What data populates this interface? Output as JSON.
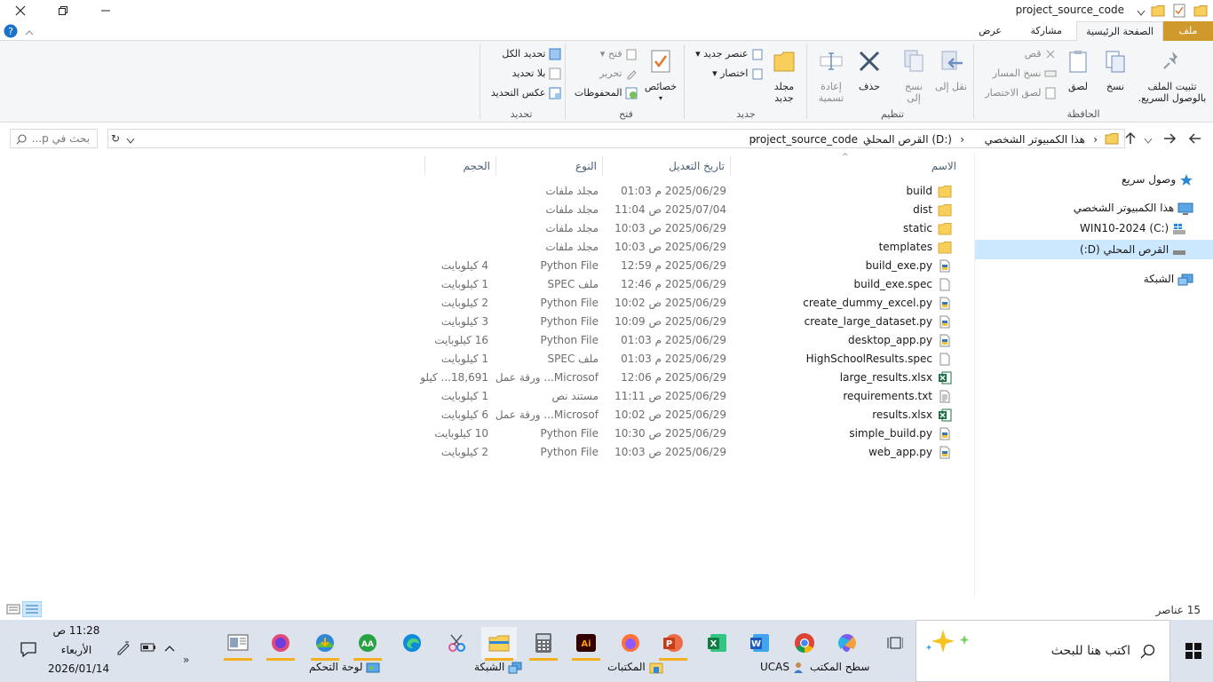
{
  "window": {
    "title": "project_source_code"
  },
  "tabs": [
    {
      "label": "ملف"
    },
    {
      "label": "الصفحة الرئيسية"
    },
    {
      "label": "مشاركة"
    },
    {
      "label": "عرض"
    }
  ],
  "ribbon": {
    "clipboard": {
      "group_label": "الحافظة",
      "pin_label": "تثبيت الملف بالوصول السريع.",
      "copy_label": "نسخ",
      "paste_label": "لصق",
      "cut_label": "قص",
      "copy_path_label": "نسخ المسار",
      "paste_shortcut_label": "لصق الاختصار"
    },
    "organize": {
      "group_label": "تنظيم",
      "move_label": "نقل إلى",
      "copyto_label": "نسخ إلى",
      "delete_label": "حذف",
      "rename_label": "إعادة تسمية"
    },
    "new": {
      "group_label": "جديد",
      "new_folder_label": "مجلد جديد",
      "new_item_label": "عنصر جديد",
      "easy_access_label": "اختصار"
    },
    "open": {
      "group_label": "فتح",
      "properties_label": "خصائص",
      "open_label": "فتح",
      "edit_label": "تحرير",
      "history_label": "المحفوظات"
    },
    "select": {
      "group_label": "تحديد",
      "select_all_label": "تحديد الكل",
      "select_none_label": "بلا تحديد",
      "invert_label": "عكس التحديد"
    }
  },
  "address": {
    "crumbs": [
      "هذا الكمبيوتر الشخصي",
      "القرص المحلي (D:)",
      "project_source_code"
    ],
    "search_placeholder": "بحث في p..."
  },
  "nav": {
    "items": [
      {
        "label": "وصول سريع"
      },
      {
        "label": "هذا الكمبيوتر الشخصي"
      },
      {
        "label": "WIN10-2024 (C:)"
      },
      {
        "label": "القرص المحلي (D:)"
      },
      {
        "label": "الشبكة"
      }
    ]
  },
  "columns": {
    "name": "الاسم",
    "date": "تاريخ التعديل",
    "type": "النوع",
    "size": "الحجم"
  },
  "files": [
    {
      "name": "build",
      "date": "2025/06/29 م 01:03",
      "type": "مجلد ملفات",
      "size": "",
      "icon": "folder"
    },
    {
      "name": "dist",
      "date": "2025/07/04 ص 11:04",
      "type": "مجلد ملفات",
      "size": "",
      "icon": "folder"
    },
    {
      "name": "static",
      "date": "2025/06/29 ص 10:03",
      "type": "مجلد ملفات",
      "size": "",
      "icon": "folder"
    },
    {
      "name": "templates",
      "date": "2025/06/29 ص 10:03",
      "type": "مجلد ملفات",
      "size": "",
      "icon": "folder"
    },
    {
      "name": "build_exe.py",
      "date": "2025/06/29 م 12:59",
      "type": "Python File",
      "size": "4 كيلوبايت",
      "icon": "python"
    },
    {
      "name": "build_exe.spec",
      "date": "2025/06/29 م 12:46",
      "type": "ملف SPEC",
      "size": "1 كيلوبايت",
      "icon": "blank"
    },
    {
      "name": "create_dummy_excel.py",
      "date": "2025/06/29 ص 10:02",
      "type": "Python File",
      "size": "2 كيلوبايت",
      "icon": "python"
    },
    {
      "name": "create_large_dataset.py",
      "date": "2025/06/29 ص 10:09",
      "type": "Python File",
      "size": "3 كيلوبايت",
      "icon": "python"
    },
    {
      "name": "desktop_app.py",
      "date": "2025/06/29 م 01:03",
      "type": "Python File",
      "size": "16 كيلوبايت",
      "icon": "python"
    },
    {
      "name": "HighSchoolResults.spec",
      "date": "2025/06/29 م 01:03",
      "type": "ملف SPEC",
      "size": "1 كيلوبايت",
      "icon": "blank"
    },
    {
      "name": "large_results.xlsx",
      "date": "2025/06/29 م 12:06",
      "type": "Microsof... ورقة عمل",
      "size": "18,691... كيلو",
      "icon": "excel"
    },
    {
      "name": "requirements.txt",
      "date": "2025/06/29 ص 11:11",
      "type": "مستند نص",
      "size": "1 كيلوبايت",
      "icon": "text"
    },
    {
      "name": "results.xlsx",
      "date": "2025/06/29 ص 10:02",
      "type": "Microsof... ورقة عمل",
      "size": "6 كيلوبايت",
      "icon": "excel"
    },
    {
      "name": "simple_build.py",
      "date": "2025/06/29 ص 10:30",
      "type": "Python File",
      "size": "10 كيلوبايت",
      "icon": "python"
    },
    {
      "name": "web_app.py",
      "date": "2025/06/29 ص 10:03",
      "type": "Python File",
      "size": "2 كيلوبايت",
      "icon": "python"
    }
  ],
  "status": {
    "count": "15 عناصر"
  },
  "taskbar": {
    "search_placeholder": "اكتب هنا للبحث",
    "labels": {
      "desktop": "سطح المكتب",
      "ucas": "UCAS",
      "libraries": "المكتبات",
      "network": "الشبكة",
      "control_panel": "لوحة التحكم"
    },
    "clock": {
      "time": "11:28 ص",
      "day": "الأربعاء",
      "date": "2026/01/14"
    }
  },
  "colors": {
    "file_tab": "#cf9a2b",
    "folder": "#f8cf5a",
    "selection": "#cce8ff",
    "taskbar": "#dde3ec",
    "accent_underline": "#f2b01e"
  }
}
